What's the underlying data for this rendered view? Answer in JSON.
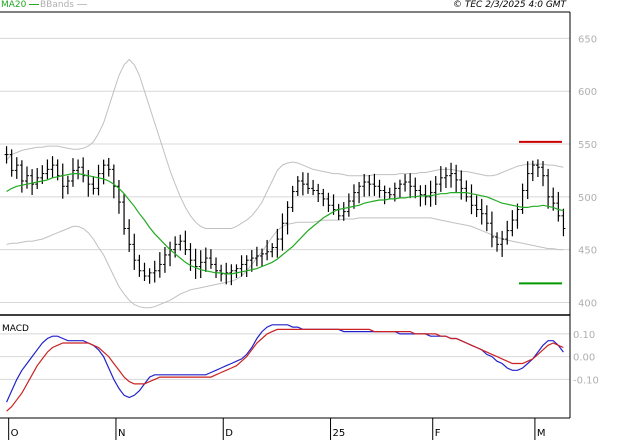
{
  "header": {
    "legend_ma20": "MA20",
    "legend_bbands": "BBands",
    "timestamp": "© TEC 2/3/2025 4:0 GMT",
    "ma20_color": "#22aa22",
    "bbands_color": "#c0c0c0"
  },
  "chart_data": [
    {
      "type": "ohlc",
      "panel": "price",
      "x_labels": [
        "O",
        "N",
        "D",
        "25",
        "F",
        "M"
      ],
      "y_ticks": [
        400,
        450,
        500,
        550,
        600,
        650
      ],
      "ylim": [
        390,
        675
      ],
      "grid": true,
      "levels": [
        {
          "label": "552",
          "value": 552,
          "color": "#cc0000"
        },
        {
          "label": "418",
          "value": 418,
          "color": "#009900"
        }
      ],
      "series_price": [
        540,
        525,
        530,
        515,
        520,
        512,
        518,
        522,
        526,
        530,
        520,
        510,
        515,
        525,
        528,
        520,
        512,
        508,
        522,
        530,
        526,
        510,
        495,
        470,
        455,
        440,
        430,
        425,
        428,
        430,
        436,
        445,
        450,
        455,
        458,
        450,
        440,
        434,
        438,
        442,
        436,
        430,
        427,
        428,
        430,
        432,
        436,
        440,
        442,
        444,
        446,
        448,
        452,
        460,
        475,
        490,
        505,
        515,
        512,
        508,
        506,
        503,
        498,
        492,
        488,
        482,
        486,
        496,
        504,
        510,
        514,
        512,
        510,
        506,
        504,
        502,
        508,
        512,
        514,
        510,
        506,
        502,
        500,
        504,
        512,
        518,
        520,
        522,
        516,
        508,
        500,
        492,
        488,
        484,
        475,
        462,
        455,
        460,
        468,
        478,
        488,
        506,
        522,
        530,
        528,
        520,
        500,
        494,
        482,
        470
      ],
      "series_ma20": [
        505,
        508,
        510,
        511,
        512,
        513,
        514,
        515,
        516,
        518,
        519,
        520,
        521,
        522,
        522,
        521,
        520,
        519,
        518,
        517,
        515,
        512,
        508,
        503,
        497,
        491,
        484,
        478,
        471,
        465,
        460,
        455,
        450,
        446,
        442,
        438,
        435,
        433,
        431,
        430,
        429,
        428,
        428,
        427,
        427,
        428,
        429,
        430,
        431,
        432,
        434,
        436,
        438,
        441,
        445,
        449,
        453,
        458,
        463,
        468,
        472,
        476,
        480,
        483,
        486,
        488,
        489,
        490,
        491,
        492,
        494,
        495,
        496,
        497,
        497,
        498,
        498,
        499,
        499,
        500,
        500,
        501,
        501,
        501,
        502,
        503,
        503,
        504,
        504,
        504,
        504,
        503,
        502,
        501,
        500,
        498,
        496,
        494,
        493,
        492,
        491,
        490,
        490,
        491,
        491,
        492,
        491,
        490,
        488,
        487
      ],
      "series_bb_upper": [
        535,
        540,
        542,
        544,
        545,
        546,
        547,
        547,
        548,
        548,
        548,
        547,
        546,
        545,
        545,
        546,
        548,
        552,
        560,
        570,
        585,
        600,
        615,
        625,
        630,
        625,
        615,
        600,
        585,
        570,
        555,
        540,
        525,
        512,
        500,
        490,
        482,
        476,
        472,
        470,
        470,
        470,
        470,
        470,
        470,
        472,
        475,
        478,
        482,
        488,
        495,
        505,
        515,
        525,
        530,
        532,
        533,
        532,
        530,
        528,
        526,
        525,
        524,
        523,
        522,
        522,
        521,
        520,
        520,
        520,
        520,
        520,
        521,
        521,
        521,
        521,
        521,
        522,
        522,
        522,
        522,
        523,
        523,
        524,
        525,
        526,
        526,
        526,
        525,
        524,
        524,
        523,
        522,
        521,
        520,
        520,
        521,
        523,
        525,
        527,
        529,
        530,
        531,
        531,
        531,
        531,
        530,
        530,
        529,
        528
      ],
      "series_bb_lower": [
        455,
        456,
        456,
        457,
        458,
        458,
        459,
        460,
        462,
        464,
        466,
        468,
        470,
        472,
        472,
        470,
        466,
        460,
        452,
        445,
        435,
        425,
        415,
        408,
        402,
        398,
        396,
        395,
        395,
        396,
        398,
        400,
        402,
        405,
        408,
        410,
        412,
        413,
        414,
        415,
        416,
        417,
        418,
        419,
        420,
        422,
        425,
        430,
        436,
        442,
        448,
        455,
        462,
        468,
        472,
        474,
        475,
        476,
        476,
        476,
        476,
        477,
        478,
        478,
        478,
        478,
        479,
        479,
        479,
        480,
        480,
        480,
        480,
        480,
        480,
        480,
        480,
        480,
        480,
        480,
        480,
        480,
        480,
        480,
        479,
        478,
        477,
        476,
        475,
        474,
        473,
        472,
        470,
        468,
        466,
        464,
        462,
        460,
        459,
        458,
        457,
        456,
        455,
        454,
        453,
        452,
        451,
        451,
        450,
        450
      ]
    },
    {
      "type": "line",
      "panel": "macd",
      "title": "MACD",
      "y_ticks": [
        0.1,
        0.0,
        -0.1
      ],
      "y_tick_labels": [
        "0.10",
        "0.00",
        "-0.10"
      ],
      "ylim": [
        -0.27,
        0.17
      ],
      "series": [
        {
          "color": "#2222cc",
          "values": [
            -0.2,
            -0.15,
            -0.1,
            -0.06,
            -0.03,
            0.0,
            0.03,
            0.06,
            0.08,
            0.09,
            0.09,
            0.08,
            0.07,
            0.07,
            0.07,
            0.07,
            0.06,
            0.05,
            0.03,
            0.0,
            -0.05,
            -0.1,
            -0.14,
            -0.17,
            -0.18,
            -0.17,
            -0.15,
            -0.12,
            -0.09,
            -0.08,
            -0.08,
            -0.08,
            -0.08,
            -0.08,
            -0.08,
            -0.08,
            -0.08,
            -0.08,
            -0.08,
            -0.08,
            -0.07,
            -0.06,
            -0.05,
            -0.04,
            -0.03,
            -0.02,
            -0.01,
            0.01,
            0.04,
            0.08,
            0.11,
            0.13,
            0.14,
            0.14,
            0.14,
            0.14,
            0.13,
            0.13,
            0.12,
            0.12,
            0.12,
            0.12,
            0.12,
            0.12,
            0.12,
            0.12,
            0.11,
            0.11,
            0.11,
            0.11,
            0.11,
            0.11,
            0.11,
            0.11,
            0.11,
            0.11,
            0.11,
            0.1,
            0.1,
            0.1,
            0.1,
            0.1,
            0.1,
            0.09,
            0.09,
            0.09,
            0.09,
            0.08,
            0.08,
            0.07,
            0.06,
            0.05,
            0.04,
            0.03,
            0.01,
            0.0,
            -0.02,
            -0.03,
            -0.05,
            -0.06,
            -0.06,
            -0.05,
            -0.03,
            -0.01,
            0.02,
            0.05,
            0.07,
            0.07,
            0.05,
            0.02
          ]
        },
        {
          "color": "#cc2222",
          "values": [
            -0.24,
            -0.22,
            -0.19,
            -0.16,
            -0.12,
            -0.08,
            -0.04,
            -0.01,
            0.02,
            0.04,
            0.05,
            0.06,
            0.06,
            0.06,
            0.06,
            0.06,
            0.06,
            0.05,
            0.04,
            0.02,
            0.0,
            -0.03,
            -0.06,
            -0.09,
            -0.11,
            -0.12,
            -0.12,
            -0.12,
            -0.11,
            -0.1,
            -0.09,
            -0.09,
            -0.09,
            -0.09,
            -0.09,
            -0.09,
            -0.09,
            -0.09,
            -0.09,
            -0.09,
            -0.09,
            -0.08,
            -0.07,
            -0.06,
            -0.05,
            -0.04,
            -0.02,
            0.0,
            0.03,
            0.06,
            0.08,
            0.1,
            0.11,
            0.12,
            0.12,
            0.12,
            0.12,
            0.12,
            0.12,
            0.12,
            0.12,
            0.12,
            0.12,
            0.12,
            0.12,
            0.12,
            0.12,
            0.12,
            0.12,
            0.12,
            0.12,
            0.12,
            0.11,
            0.11,
            0.11,
            0.11,
            0.11,
            0.11,
            0.11,
            0.11,
            0.1,
            0.1,
            0.1,
            0.1,
            0.1,
            0.09,
            0.09,
            0.08,
            0.08,
            0.07,
            0.06,
            0.05,
            0.04,
            0.03,
            0.02,
            0.01,
            0.0,
            -0.01,
            -0.02,
            -0.03,
            -0.03,
            -0.03,
            -0.02,
            -0.01,
            0.01,
            0.03,
            0.05,
            0.06,
            0.05,
            0.04
          ]
        }
      ]
    }
  ]
}
